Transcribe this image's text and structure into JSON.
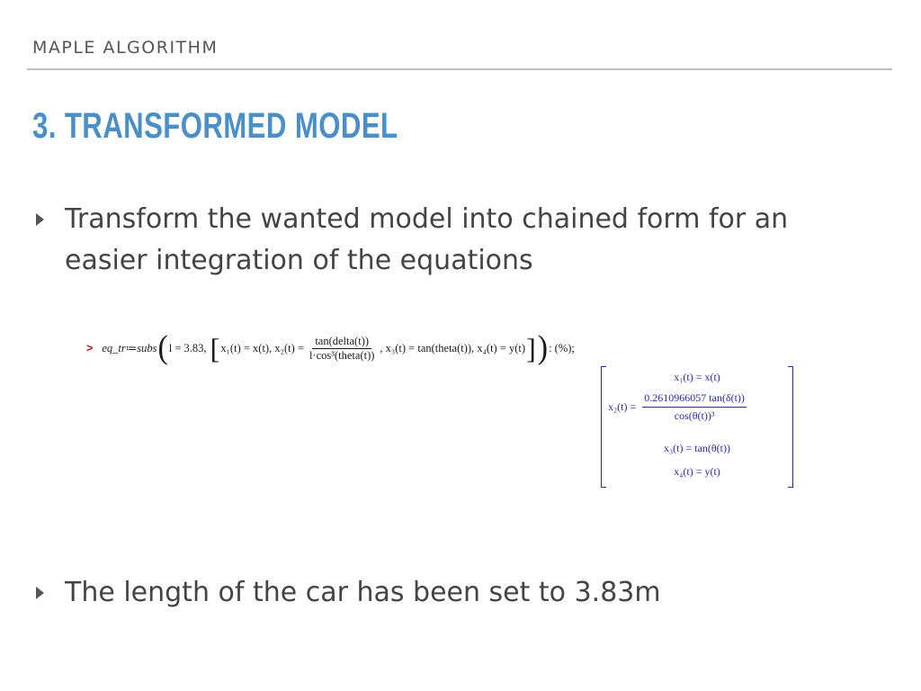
{
  "header": {
    "section": "MAPLE ALGORITHM"
  },
  "title": "3. TRANSFORMED MODEL",
  "bullets": [
    {
      "text": "Transform the wanted model into chained form for an easier integration of the equations"
    },
    {
      "text": "The length of the car has been set to 3.83m"
    }
  ],
  "maple": {
    "prompt": ">",
    "cmd_name": "eq_tr",
    "assign": " ≔ ",
    "func": "subs",
    "l_assign": "l = 3.83,",
    "x1_eq": "x₁(t) = x(t),",
    "x2_lhs": "x₂(t) =",
    "x2_num": "tan(delta(t))",
    "x2_den": "l·cos³(theta(t))",
    "x3_eq": ", x₃(t) = tan(theta(t)),",
    "x4_eq": "x₄(t) = y(t)",
    "tail": " : (%);",
    "output": {
      "r1": "x₁(t) = x(t)",
      "r2_lhs": "x₂(t) =",
      "r2_num": "0.2610966057 tan(δ(t))",
      "r2_den": "cos(θ(t))³",
      "r3": "x₃(t) = tan(θ(t))",
      "r4": "x₄(t) = y(t)"
    }
  }
}
